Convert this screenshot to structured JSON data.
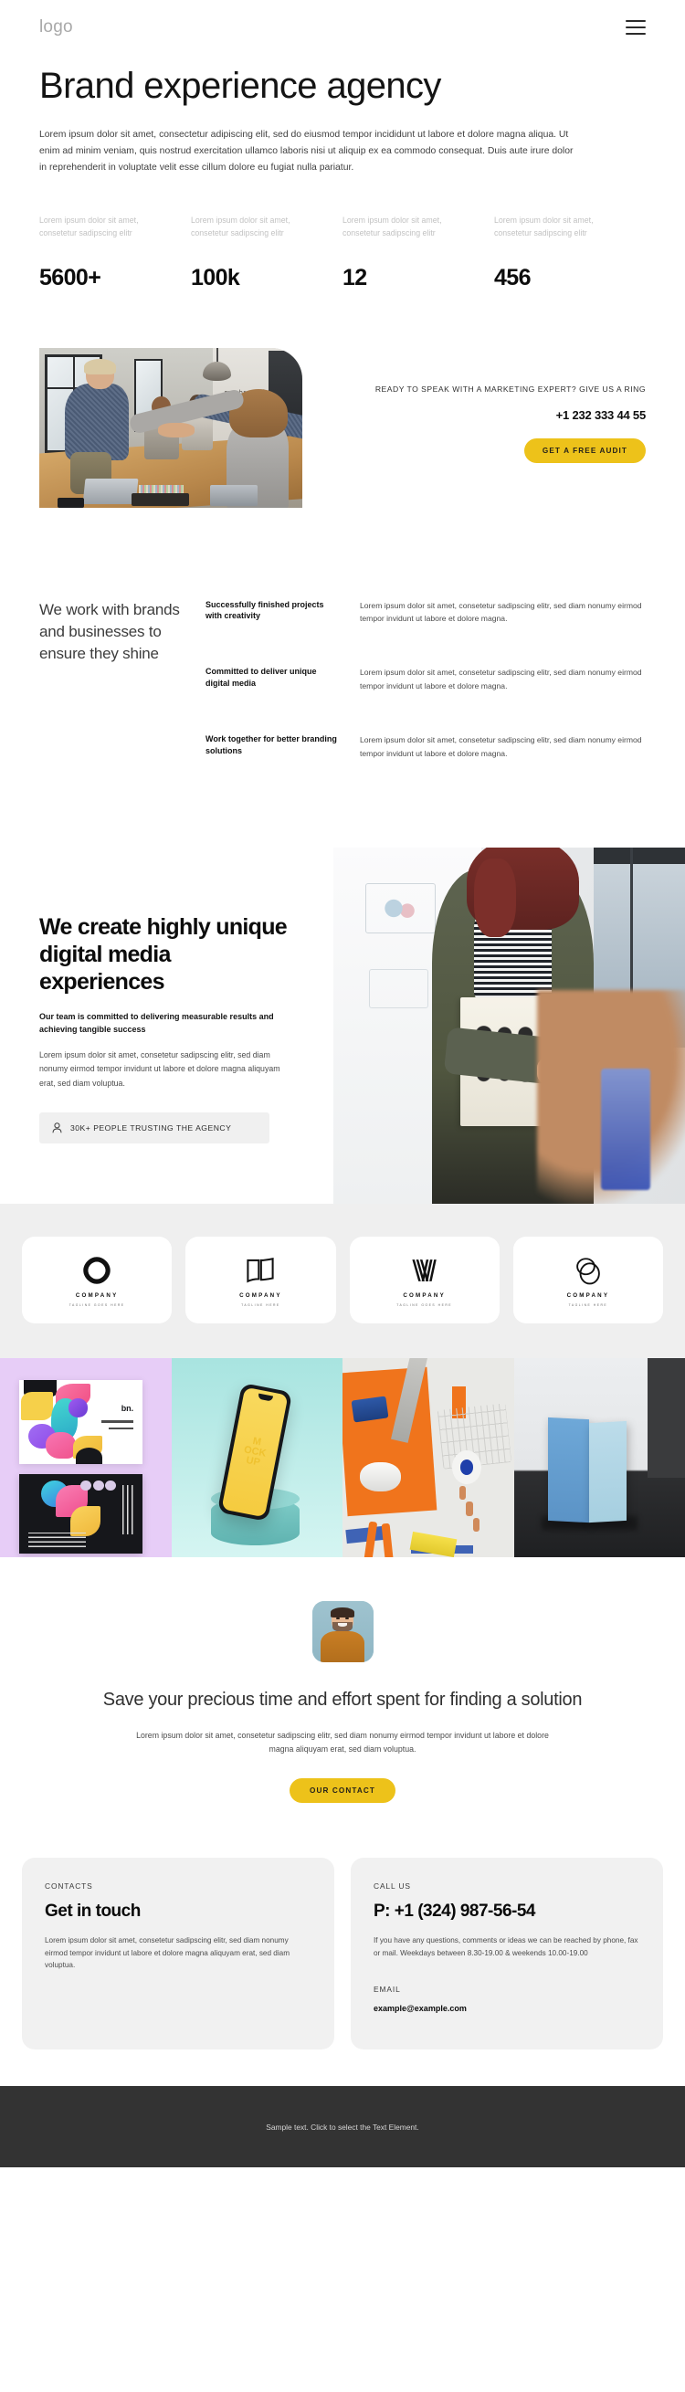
{
  "header": {
    "logo": "logo",
    "menu_icon": "hamburger-menu-icon"
  },
  "hero": {
    "title": "Brand experience agency",
    "lead": "Lorem ipsum dolor sit amet, consectetur adipiscing elit, sed do eiusmod tempor incididunt ut labore et dolore magna aliqua. Ut enim ad minim veniam, quis nostrud exercitation ullamco laboris nisi ut aliquip ex ea commodo consequat. Duis aute irure dolor in reprehenderit in voluptate velit esse cillum dolore eu fugiat nulla pariatur."
  },
  "stats": [
    {
      "caption": "Lorem ipsum dolor sit amet, consetetur sadipscing elitr",
      "number": "5600+"
    },
    {
      "caption": "Lorem ipsum dolor sit amet, consetetur sadipscing elitr",
      "number": "100k"
    },
    {
      "caption": "Lorem ipsum dolor sit amet, consetetur sadipscing elitr",
      "number": "12"
    },
    {
      "caption": "Lorem ipsum dolor sit amet, consetetur sadipscing elitr",
      "number": "456"
    }
  ],
  "cta": {
    "kicker": "READY TO SPEAK WITH A MARKETING EXPERT? GIVE US A RING",
    "phone": "+1 232 333 44 55",
    "button": "GET A FREE AUDIT",
    "accent_color": "#edc21a",
    "photo_alt": "business-handshake-meeting-photo"
  },
  "work_with": {
    "heading": "We work with brands and businesses to ensure they shine",
    "items": [
      {
        "title": "Successfully finished projects with creativity",
        "description": "Lorem ipsum dolor sit amet, consetetur sadipscing elitr, sed diam nonumy eirmod tempor invidunt ut labore et dolore magna."
      },
      {
        "title": "Committed to deliver unique digital media",
        "description": "Lorem ipsum dolor sit amet, consetetur sadipscing elitr, sed diam nonumy eirmod tempor invidunt ut labore et dolore magna."
      },
      {
        "title": "Work together for better branding solutions",
        "description": "Lorem ipsum dolor sit amet, consetetur sadipscing elitr, sed diam nonumy eirmod tempor invidunt ut labore et dolore magna."
      }
    ]
  },
  "create": {
    "heading": "We create highly unique digital media experiences",
    "subheading": "Our team is committed to delivering measurable results and achieving tangible success",
    "body": "Lorem ipsum dolor sit amet, consetetur sadipscing elitr, sed diam nonumy eirmod tempor invidunt ut labore et dolore magna aliquyam erat, sed diam voluptua.",
    "badge_label": "30K+ PEOPLE TRUSTING THE AGENCY",
    "badge_icon": "person-icon",
    "photo_alt": "designer-holding-sketchbook-photo"
  },
  "logos": [
    {
      "mark": "oval-knot-logo-icon",
      "name": "COMPANY",
      "tagline": "TAGLINE GOES HERE"
    },
    {
      "mark": "open-book-logo-icon",
      "name": "COMPANY",
      "tagline": "TAGLINE HERE"
    },
    {
      "mark": "striped-v-logo-icon",
      "name": "COMPANY",
      "tagline": "TAGLINE GOES HERE"
    },
    {
      "mark": "overlapping-circles-logo-icon",
      "name": "COMPANY",
      "tagline": "TAGLINE HERE"
    }
  ],
  "gallery": [
    {
      "alt": "brand-identity-cards-artwork",
      "brand_text": "bn."
    },
    {
      "alt": "phone-mockup-on-podium",
      "screen_text": "M\nOCK\nUP"
    },
    {
      "alt": "desk-stationery-flatlay"
    },
    {
      "alt": "blue-paper-cards-mockup"
    }
  ],
  "save": {
    "avatar_alt": "smiling-man-avatar",
    "heading": "Save your precious time and effort spent for finding a solution",
    "body": "Lorem ipsum dolor sit amet, consetetur sadipscing elitr, sed diam nonumy eirmod tempor invidunt ut labore et dolore magna aliquyam erat, sed diam voluptua.",
    "button": "OUR CONTACT"
  },
  "contact": {
    "left": {
      "eyebrow": "CONTACTS",
      "title": "Get in touch",
      "text": "Lorem ipsum dolor sit amet, consetetur sadipscing elitr, sed diam nonumy eirmod tempor invidunt ut labore et dolore magna aliquyam erat, sed diam voluptua."
    },
    "right": {
      "eyebrow": "CALL US",
      "phone": "P: +1 (324) 987-56-54",
      "text": "If you have any questions, comments or ideas we can be reached by phone, fax or mail. Weekdays between 8.30-19.00 & weekends 10.00-19.00",
      "email_label": "EMAIL",
      "email": "example@example.com"
    }
  },
  "footer": {
    "text": "Sample text. Click to select the Text Element."
  }
}
